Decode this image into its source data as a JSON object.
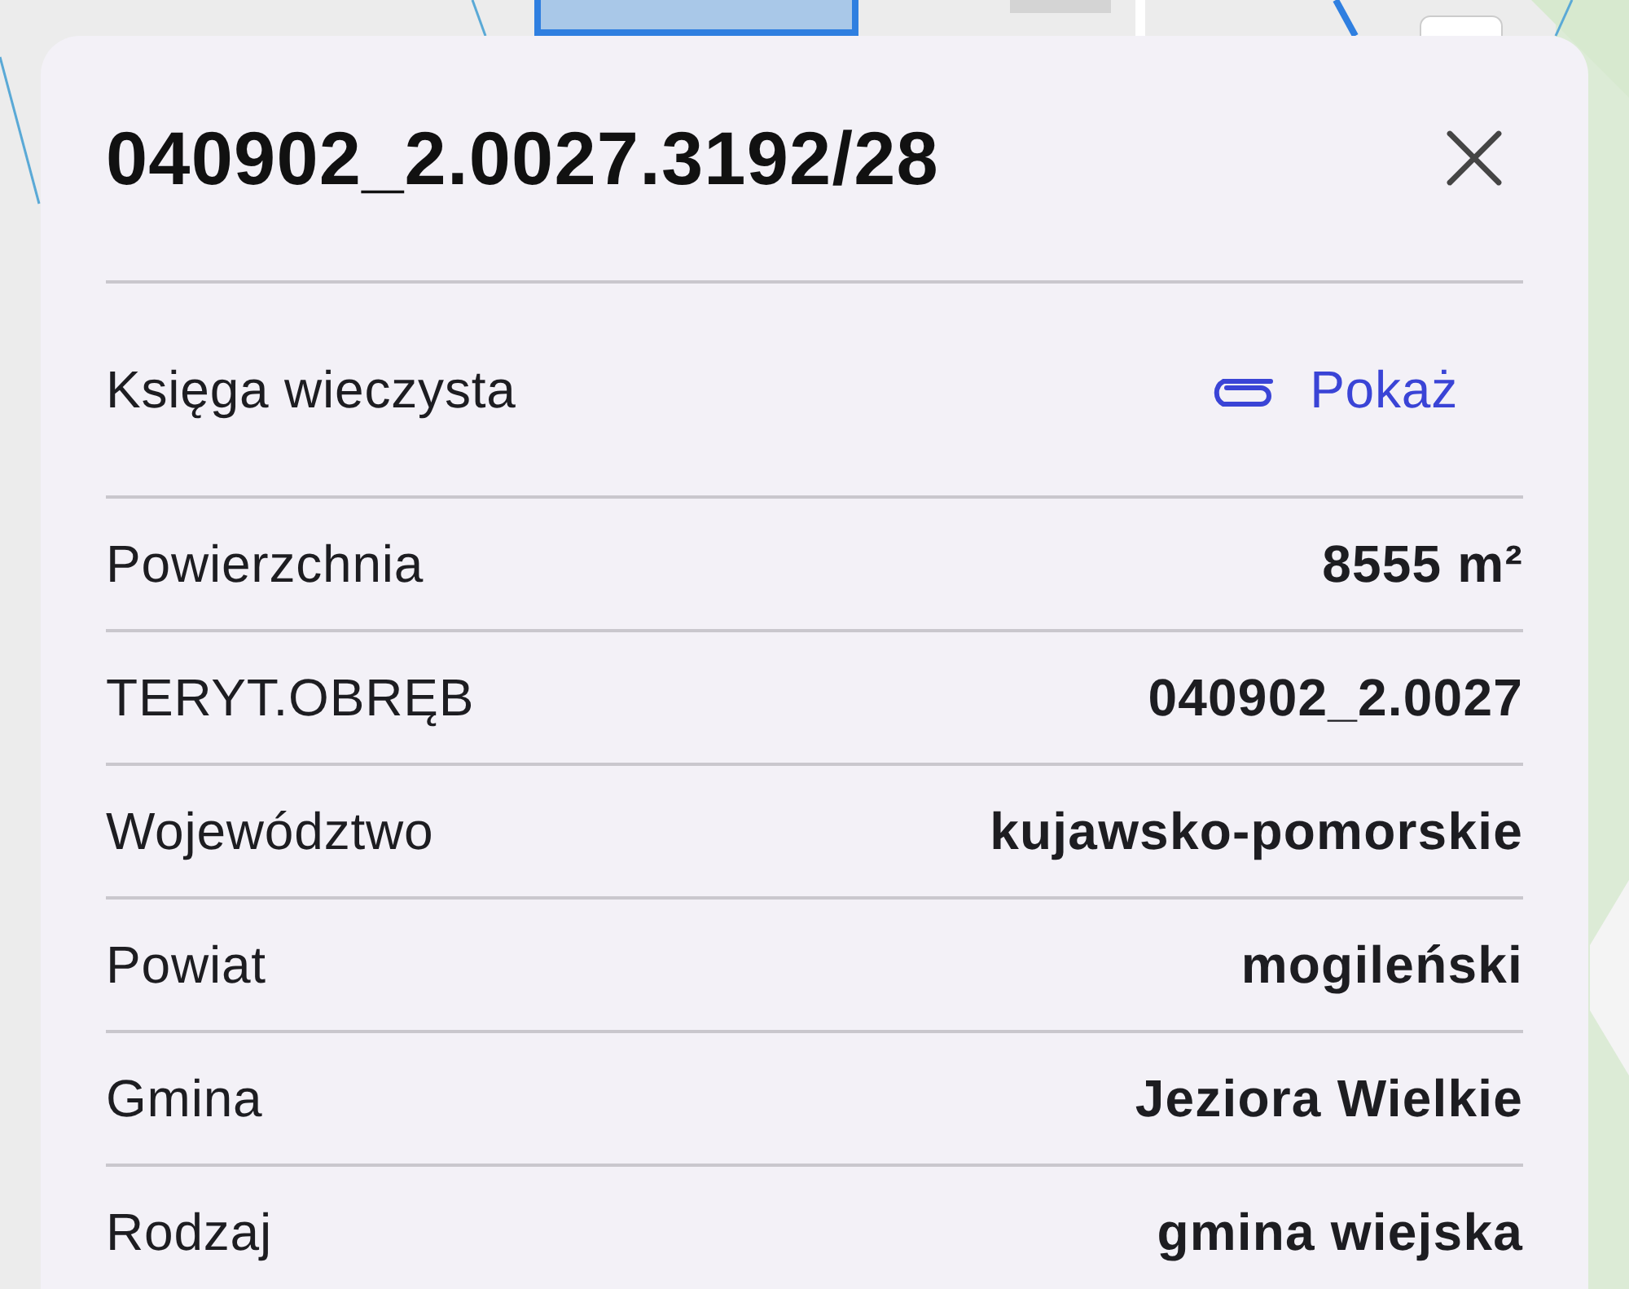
{
  "title": "040902_2.0027.3192/28",
  "land_register": {
    "label": "Księga wieczysta",
    "link": "Pokaż"
  },
  "attributes": [
    {
      "label": "Powierzchnia",
      "value": "8555 m²"
    },
    {
      "label": "TERYT.OBRĘB",
      "value": "040902_2.0027"
    },
    {
      "label": "Województwo",
      "value": "kujawsko-pomorskie"
    },
    {
      "label": "Powiat",
      "value": "mogileński"
    },
    {
      "label": "Gmina",
      "value": "Jeziora Wielkie"
    },
    {
      "label": "Rodzaj",
      "value": "gmina wiejska"
    }
  ]
}
